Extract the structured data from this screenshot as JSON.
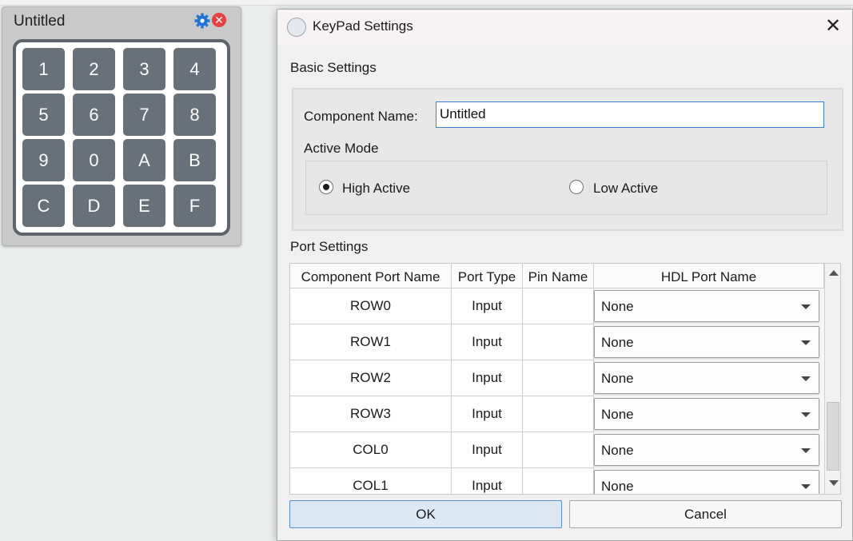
{
  "widget": {
    "title": "Untitled",
    "keys": [
      "1",
      "2",
      "3",
      "4",
      "5",
      "6",
      "7",
      "8",
      "9",
      "0",
      "A",
      "B",
      "C",
      "D",
      "E",
      "F"
    ],
    "gear_icon": "gear-icon",
    "close_icon": "close-icon",
    "close_glyph": "✕"
  },
  "dialog": {
    "title": "KeyPad Settings",
    "close_glyph": "✕",
    "basic_settings": "Basic Settings",
    "component_name_label": "Component Name:",
    "component_name_value": "Untitled",
    "active_mode_label": "Active Mode",
    "active_mode_options": [
      "High Active",
      "Low Active"
    ],
    "active_mode_selected": "High Active",
    "port_settings": "Port Settings",
    "columns": [
      "Component Port Name",
      "Port Type",
      "Pin Name",
      "HDL Port Name"
    ],
    "ports": [
      {
        "name": "ROW0",
        "type": "Input",
        "pin": "",
        "hdl": "None"
      },
      {
        "name": "ROW1",
        "type": "Input",
        "pin": "",
        "hdl": "None"
      },
      {
        "name": "ROW2",
        "type": "Input",
        "pin": "",
        "hdl": "None"
      },
      {
        "name": "ROW3",
        "type": "Input",
        "pin": "",
        "hdl": "None"
      },
      {
        "name": "COL0",
        "type": "Input",
        "pin": "",
        "hdl": "None"
      },
      {
        "name": "COL1",
        "type": "Input",
        "pin": "",
        "hdl": "None"
      }
    ],
    "ok_label": "OK",
    "cancel_label": "Cancel"
  },
  "colors": {
    "accent": "#3d7fd4",
    "key_bg": "#68707a",
    "close_red": "#e8403f",
    "gear_blue": "#1e73d8"
  }
}
